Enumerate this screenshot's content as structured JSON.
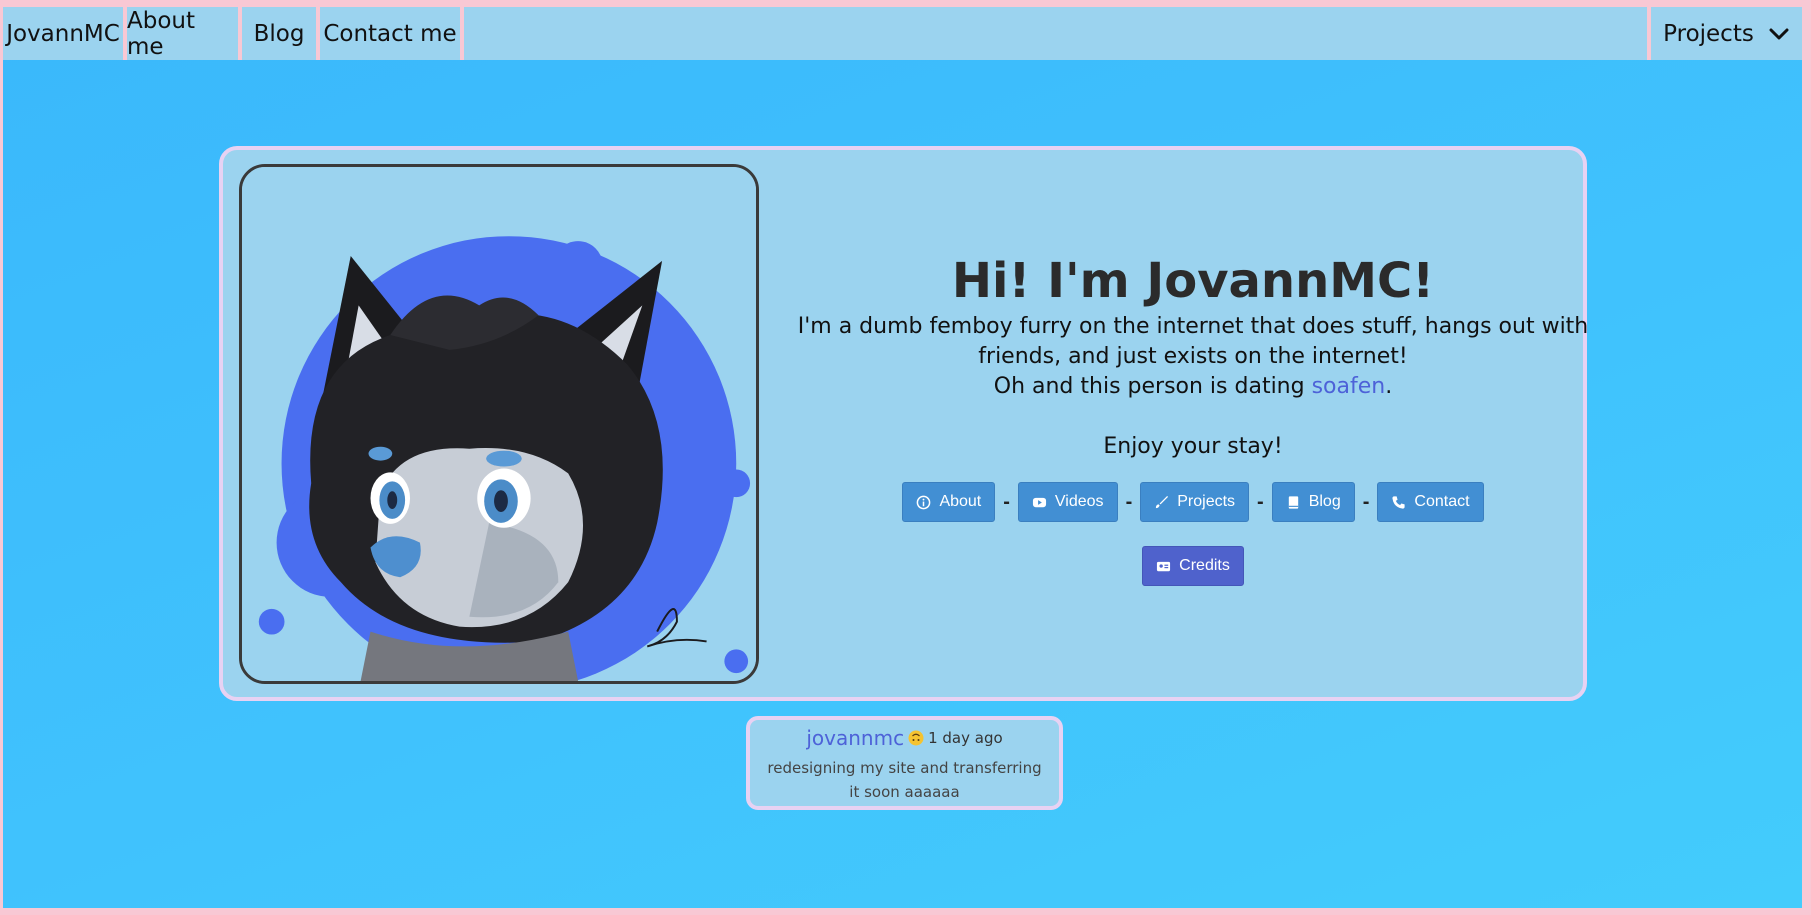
{
  "nav": {
    "brand": "JovannMC",
    "items": [
      {
        "label": "About me"
      },
      {
        "label": "Blog"
      },
      {
        "label": "Contact me"
      }
    ],
    "dropdown_label": "Projects"
  },
  "hero": {
    "title": "Hi! I'm JovannMC!",
    "description": "I'm a dumb femboy furry on the internet that does stuff, hangs out with friends, and just exists on the internet!",
    "dating_prefix": "Oh and this person is dating ",
    "dating_link": "soafen",
    "dating_suffix": ".",
    "greeting": "Enjoy your stay!",
    "buttons": [
      {
        "label": "About",
        "icon": "info-icon"
      },
      {
        "label": "Videos",
        "icon": "youtube-icon"
      },
      {
        "label": "Projects",
        "icon": "brush-icon"
      },
      {
        "label": "Blog",
        "icon": "book-icon"
      },
      {
        "label": "Contact",
        "icon": "phone-icon"
      }
    ],
    "separator": "-",
    "credits_button": {
      "label": "Credits",
      "icon": "id-card-icon"
    }
  },
  "status": {
    "username": "jovannmc",
    "emoji": "upside-down-face-emoji",
    "time": "1 day ago",
    "message": "redesigning my site and transferring it soon aaaaaa"
  },
  "colors": {
    "page_border": "#f8c8d4",
    "background": "#40c2fd",
    "card": "#9bd3ef",
    "button": "#428fd3",
    "credits_button": "#4f62cc",
    "link": "#4d62d8"
  }
}
